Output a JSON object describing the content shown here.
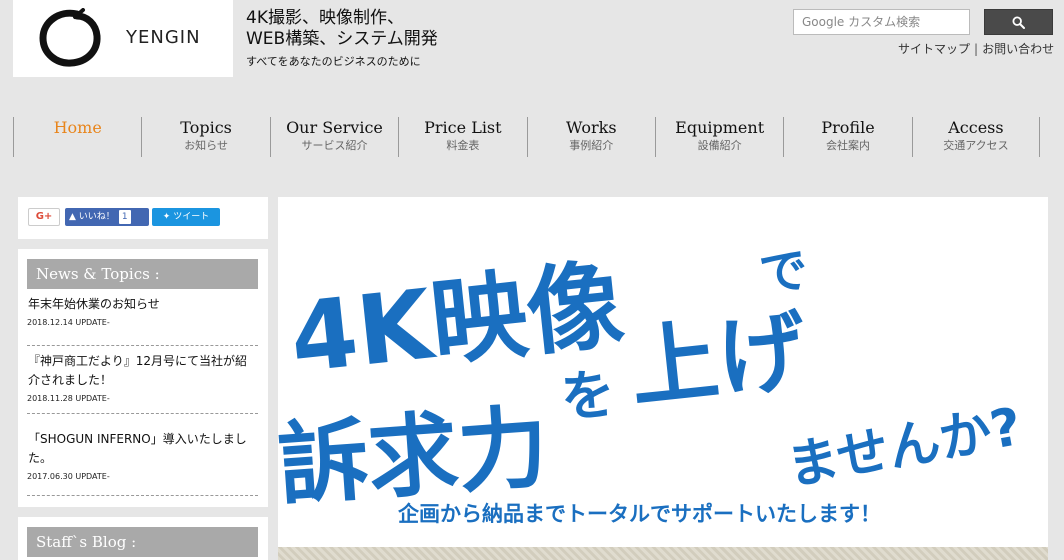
{
  "header": {
    "logo_text": "YENGIN",
    "tagline_line1": "4K撮影、映像制作、",
    "tagline_line2": "WEB構築、システム開発",
    "tagline_line3": "すべてをあなたのビジネスのために",
    "search_placeholder": "Google カスタム検索",
    "link_sitemap": "サイトマップ",
    "link_separator": "|",
    "link_contact": "お問い合わせ"
  },
  "nav": {
    "items": [
      {
        "en": "Home",
        "jp": ""
      },
      {
        "en": "Topics",
        "jp": "お知らせ"
      },
      {
        "en": "Our Service",
        "jp": "サービス紹介"
      },
      {
        "en": "Price List",
        "jp": "料金表"
      },
      {
        "en": "Works",
        "jp": "事例紹介"
      },
      {
        "en": "Equipment",
        "jp": "設備紹介"
      },
      {
        "en": "Profile",
        "jp": "会社案内"
      },
      {
        "en": "Access",
        "jp": "交通アクセス"
      }
    ]
  },
  "social": {
    "gplus": "G+",
    "like": "いいね！",
    "like_count": "1",
    "tweet": "ツイート"
  },
  "news": {
    "heading": "News & Topics :",
    "items": [
      {
        "title": "年末年始休業のお知らせ",
        "date": "2018.12.14 UPDATE-"
      },
      {
        "title": "『神戸商工だより』12月号にて当社が紹介されました！",
        "date": "2018.11.28 UPDATE-"
      },
      {
        "title": "「SHOGUN INFERNO」導入いたしました。",
        "date": "2017.06.30 UPDATE-"
      }
    ]
  },
  "blog": {
    "heading": "Staff`s Blog :"
  },
  "hero": {
    "line1a": "4K映像",
    "line1b": "で",
    "line2a": "訴求力",
    "line2b": "を",
    "line2c": "上げ",
    "line3": "ませんか?",
    "subline": "企画から納品までトータルでサポートいたします！",
    "color": "#1a6fc0"
  },
  "colors": {
    "accent": "#e8851c",
    "panel_head": "#a9a9a9",
    "search_button": "#4a4a4a",
    "facebook": "#4267b2",
    "twitter": "#1b95e0"
  }
}
